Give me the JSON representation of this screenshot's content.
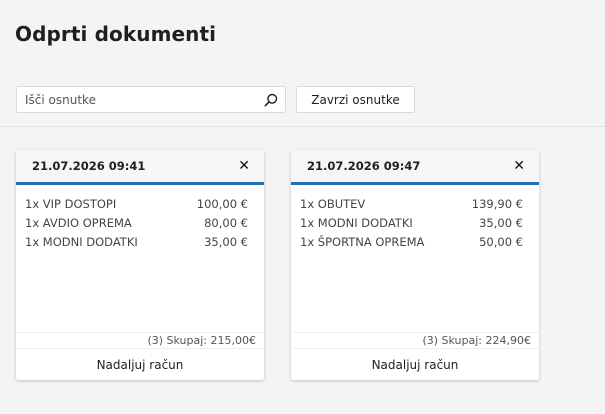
{
  "page": {
    "title": "Odprti dokumenti"
  },
  "toolbar": {
    "search_placeholder": "Išči osnutke",
    "search_icon": "search-icon",
    "discard_label": "Zavrzi osnutke"
  },
  "cards": [
    {
      "date": "21.07.2026 09:41",
      "close_icon": "close-icon",
      "items": [
        {
          "name": "1x VIP DOSTOPI",
          "price": "100,00 €"
        },
        {
          "name": "1x AVDIO OPREMA",
          "price": "80,00 €"
        },
        {
          "name": "1x MODNI DODATKI",
          "price": "35,00 €"
        }
      ],
      "total": "(3) Skupaj: 215,00€",
      "continue_label": "Nadaljuj račun"
    },
    {
      "date": "21.07.2026 09:47",
      "close_icon": "close-icon",
      "items": [
        {
          "name": "1x OBUTEV",
          "price": "139,90 €"
        },
        {
          "name": "1x MODNI DODATKI",
          "price": "35,00 €"
        },
        {
          "name": "1x ŠPORTNA OPREMA",
          "price": "50,00 €"
        }
      ],
      "total": "(3) Skupaj: 224,90€",
      "continue_label": "Nadaljuj račun"
    }
  ],
  "colors": {
    "accent": "#1e6fb5",
    "background": "#f4f4f4"
  }
}
